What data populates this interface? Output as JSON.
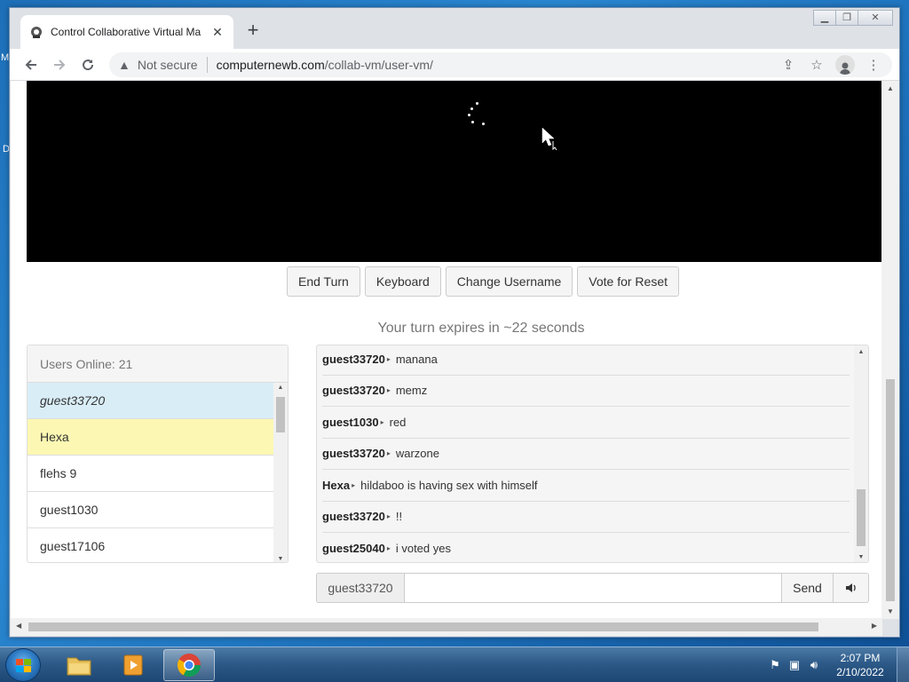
{
  "desktop": {
    "frag1": "M",
    "frag2": "D"
  },
  "browser": {
    "tab_title": "Control Collaborative Virtual Ma",
    "new_tab": "+",
    "omnibox": {
      "security_label": "Not secure",
      "url_host": "computernewb.com",
      "url_path": "/collab-vm/user-vm/"
    }
  },
  "vm": {
    "buttons": {
      "end_turn": "End Turn",
      "keyboard": "Keyboard",
      "change_username": "Change Username",
      "vote_reset": "Vote for Reset"
    },
    "turn_status": "Your turn expires in ~22 seconds"
  },
  "users": {
    "header": "Users Online: 21",
    "list": [
      "guest33720",
      "Hexa",
      "flehs 9",
      "guest1030",
      "guest17106"
    ]
  },
  "chat": {
    "messages": [
      {
        "user": "guest33720",
        "text": "manana"
      },
      {
        "user": "guest33720",
        "text": "memz"
      },
      {
        "user": "guest1030",
        "text": "red"
      },
      {
        "user": "guest33720",
        "text": "warzone"
      },
      {
        "user": "Hexa",
        "text": "hildaboo is having sex with himself"
      },
      {
        "user": "guest33720",
        "text": "!!"
      },
      {
        "user": "guest25040",
        "text": "i voted yes"
      }
    ],
    "nickname": "guest33720",
    "input_value": "",
    "send_label": "Send"
  },
  "taskbar": {
    "time": "2:07 PM",
    "date": "2/10/2022"
  },
  "colors": {
    "highlight_self": "#d9edf7",
    "highlight_turn": "#fcf8b3",
    "vm_background": "#000000"
  }
}
